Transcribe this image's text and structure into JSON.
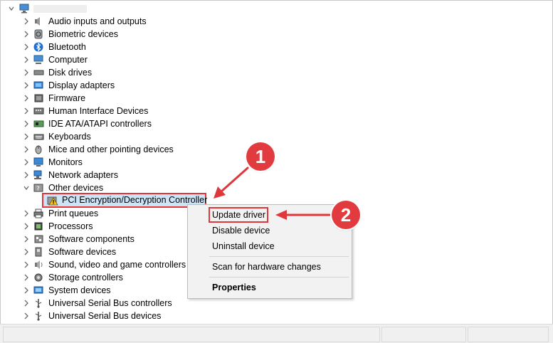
{
  "tree": {
    "categories": [
      {
        "label": "Audio inputs and outputs",
        "icon": "speaker-icon"
      },
      {
        "label": "Biometric devices",
        "icon": "fingerprint-icon"
      },
      {
        "label": "Bluetooth",
        "icon": "bluetooth-icon"
      },
      {
        "label": "Computer",
        "icon": "computer-icon"
      },
      {
        "label": "Disk drives",
        "icon": "disk-drive-icon"
      },
      {
        "label": "Display adapters",
        "icon": "display-adapter-icon"
      },
      {
        "label": "Firmware",
        "icon": "firmware-icon"
      },
      {
        "label": "Human Interface Devices",
        "icon": "hid-icon"
      },
      {
        "label": "IDE ATA/ATAPI controllers",
        "icon": "ide-controller-icon"
      },
      {
        "label": "Keyboards",
        "icon": "keyboard-icon"
      },
      {
        "label": "Mice and other pointing devices",
        "icon": "mouse-icon"
      },
      {
        "label": "Monitors",
        "icon": "monitor-icon"
      },
      {
        "label": "Network adapters",
        "icon": "network-adapter-icon"
      },
      {
        "label": "Other devices",
        "icon": "other-devices-icon"
      },
      {
        "label": "Print queues",
        "icon": "printer-icon"
      },
      {
        "label": "Processors",
        "icon": "processor-icon"
      },
      {
        "label": "Software components",
        "icon": "software-component-icon"
      },
      {
        "label": "Software devices",
        "icon": "software-device-icon"
      },
      {
        "label": "Sound, video and game controllers",
        "icon": "sound-icon"
      },
      {
        "label": "Storage controllers",
        "icon": "storage-controller-icon"
      },
      {
        "label": "System devices",
        "icon": "system-devices-icon"
      },
      {
        "label": "Universal Serial Bus controllers",
        "icon": "usb-icon"
      },
      {
        "label": "Universal Serial Bus devices",
        "icon": "usb-icon"
      }
    ],
    "selected_child": {
      "label": "PCI Encryption/Decryption Controller",
      "icon": "warning-icon"
    }
  },
  "context_menu": {
    "items": [
      "Update driver",
      "Disable device",
      "Uninstall device",
      "Scan for hardware changes",
      "Properties"
    ]
  },
  "callouts": {
    "first": "1",
    "second": "2"
  },
  "colors": {
    "annotation": "#e0373b",
    "selection": "#cce4f7",
    "menu_bg": "#f2f2f2"
  }
}
